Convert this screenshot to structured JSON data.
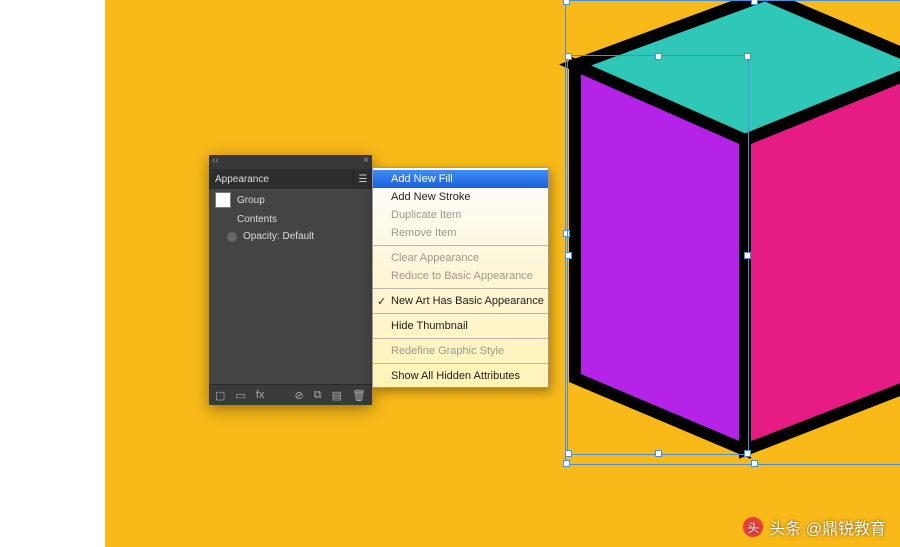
{
  "canvas": {
    "bg_color": "#f8b919",
    "cube": {
      "top_color": "#2fc7b8",
      "front_color": "#b623e8",
      "side_color": "#e61c84",
      "stroke": "#000000"
    }
  },
  "panel": {
    "title": "Appearance",
    "rows": {
      "group_label": "Group",
      "contents_label": "Contents",
      "opacity_label": "Opacity:",
      "opacity_value": "Default"
    },
    "footer_fx": "fx"
  },
  "flyout": {
    "items": [
      {
        "label": "Add New Fill",
        "state": "highlight"
      },
      {
        "label": "Add New Stroke",
        "state": "enabled"
      },
      {
        "label": "Duplicate Item",
        "state": "disabled"
      },
      {
        "label": "Remove Item",
        "state": "disabled"
      },
      {
        "sep": true
      },
      {
        "label": "Clear Appearance",
        "state": "disabled"
      },
      {
        "label": "Reduce to Basic Appearance",
        "state": "disabled"
      },
      {
        "sep": true
      },
      {
        "label": "New Art Has Basic Appearance",
        "state": "enabled",
        "check": true
      },
      {
        "sep": true
      },
      {
        "label": "Hide Thumbnail",
        "state": "enabled"
      },
      {
        "sep": true
      },
      {
        "label": "Redefine Graphic Style",
        "state": "disabled"
      },
      {
        "sep": true
      },
      {
        "label": "Show All Hidden Attributes",
        "state": "enabled"
      }
    ]
  },
  "watermark": {
    "text": "头条 @鼎锐教育"
  }
}
